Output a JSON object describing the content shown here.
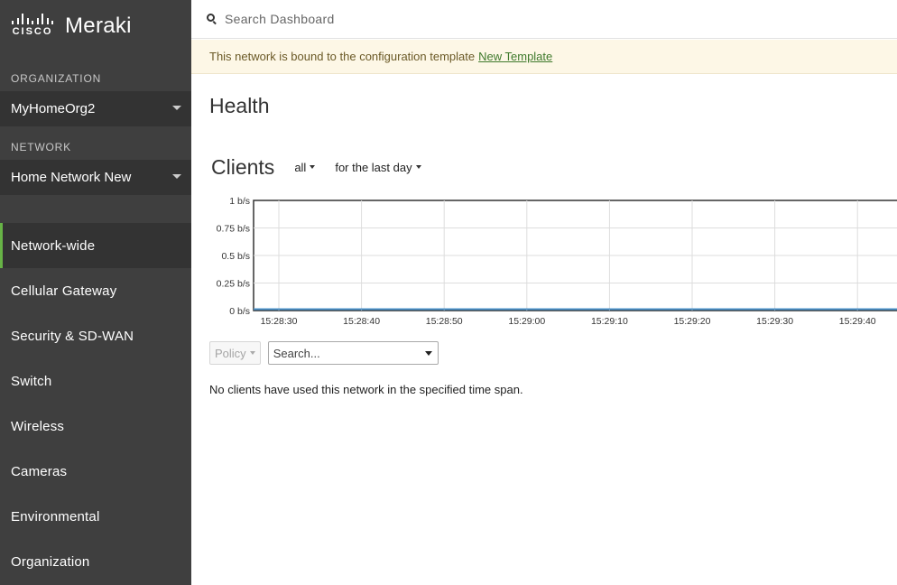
{
  "brand": {
    "cisco": "CISCO",
    "product": "Meraki"
  },
  "sidebar": {
    "organization_label": "ORGANIZATION",
    "organization_value": "MyHomeOrg2",
    "network_label": "NETWORK",
    "network_value": "Home Network New",
    "accent_color": "#67b346",
    "items": [
      {
        "label": "Network-wide",
        "active": true
      },
      {
        "label": "Cellular Gateway"
      },
      {
        "label": "Security & SD-WAN"
      },
      {
        "label": "Switch"
      },
      {
        "label": "Wireless"
      },
      {
        "label": "Cameras"
      },
      {
        "label": "Environmental"
      },
      {
        "label": "Organization"
      }
    ]
  },
  "search": {
    "placeholder": "Search Dashboard",
    "icon": "search-icon"
  },
  "banner": {
    "text": "This network is bound to the configuration template",
    "link": "New Template"
  },
  "page": {
    "title": "Health"
  },
  "clients": {
    "title": "Clients",
    "filter_all": "all",
    "filter_time": "for the last day"
  },
  "chart_data": {
    "type": "line",
    "y_ticks": [
      "1 b/s",
      "0.75 b/s",
      "0.5 b/s",
      "0.25 b/s",
      "0 b/s"
    ],
    "x_ticks": [
      "15:28:30",
      "15:28:40",
      "15:28:50",
      "15:29:00",
      "15:29:10",
      "15:29:20",
      "15:29:30",
      "15:29:40"
    ],
    "ylim": [
      0,
      1
    ],
    "grid": true,
    "series": [
      {
        "values": [
          0,
          0,
          0,
          0,
          0,
          0,
          0,
          0
        ],
        "color": "#4a90c8"
      }
    ]
  },
  "filters": {
    "policy_label": "Policy",
    "search_placeholder": "Search..."
  },
  "empty_message": "No clients have used this network in the specified time span."
}
